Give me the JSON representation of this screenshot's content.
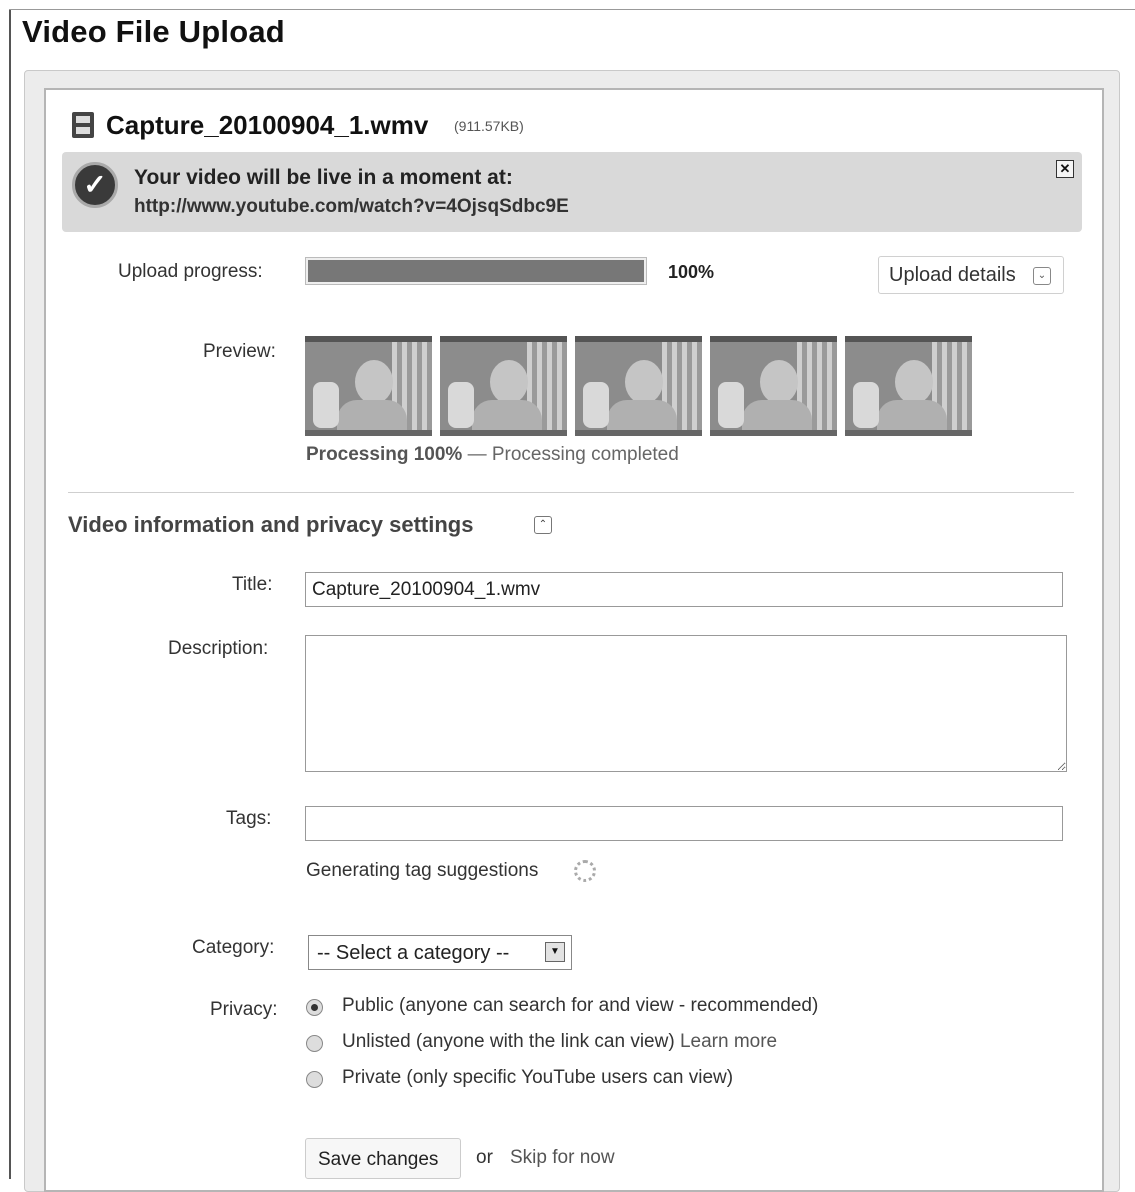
{
  "page": {
    "title": "Video File Upload"
  },
  "file": {
    "name": "Capture_20100904_1.wmv",
    "size": "(911.57KB)"
  },
  "notice": {
    "message": "Your video will be live in a moment at:",
    "url": "http://www.youtube.com/watch?v=4OjsqSdbc9E",
    "close_icon": "close-icon"
  },
  "upload": {
    "label": "Upload progress:",
    "progress_fraction": 1.0,
    "percent_text": "100%",
    "details_button": "Upload details"
  },
  "preview": {
    "label": "Preview:",
    "thumbnail_count": 5,
    "processing_bold": "Processing 100%",
    "processing_rest": " — Processing completed"
  },
  "info": {
    "section_title": "Video information and privacy settings",
    "title_label": "Title:",
    "title_value": "Capture_20100904_1.wmv",
    "description_label": "Description:",
    "description_value": "",
    "tags_label": "Tags:",
    "tags_value": "",
    "tag_suggestions": "Generating tag suggestions",
    "category_label": "Category:",
    "category_selected": "-- Select a category --",
    "privacy_label": "Privacy:",
    "privacy_options": [
      {
        "label": "Public (anyone can search for and view - recommended)",
        "checked": true
      },
      {
        "label": "Unlisted (anyone with the link can view)",
        "link": "Learn more",
        "checked": false
      },
      {
        "label": "Private (only specific YouTube users can view)",
        "checked": false
      }
    ]
  },
  "actions": {
    "save": "Save changes",
    "or": "or",
    "skip": "Skip for now"
  },
  "colors": {
    "progress_fill": "#777777",
    "notice_bg": "#d9d9d9"
  }
}
